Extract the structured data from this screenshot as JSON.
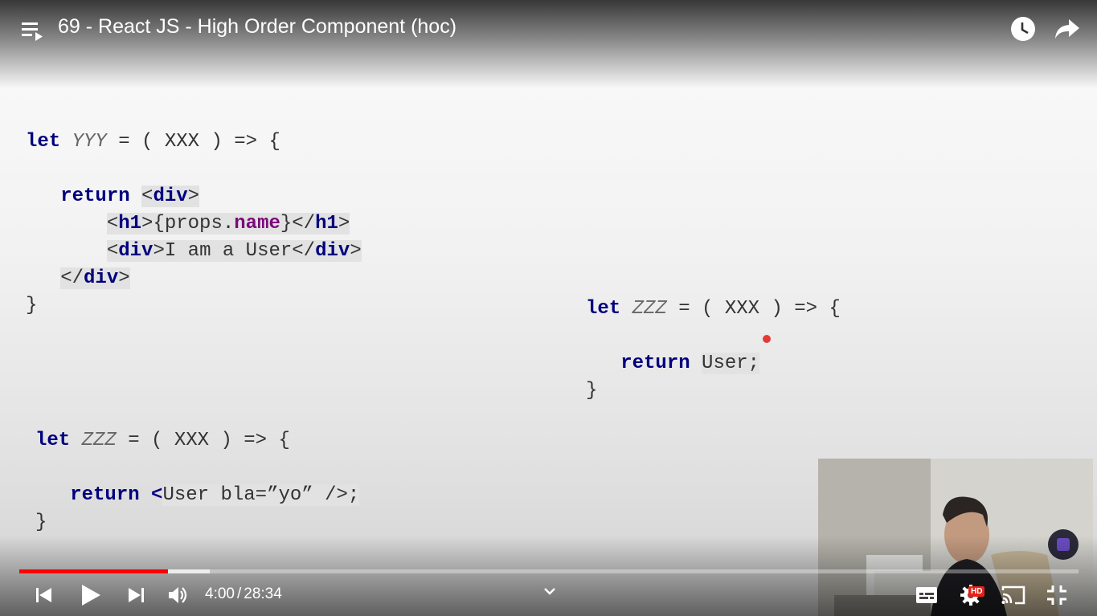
{
  "header": {
    "title": "69 - React JS - High Order Component (hoc)",
    "playlist_icon": "playlist-icon",
    "watch_later_icon": "clock-icon",
    "share_icon": "share-icon"
  },
  "slide": {
    "block1": {
      "l1_kw": "let",
      "l1_name": "YYY",
      "l1_rest": " = ( XXX ) => {",
      "l2_kw": "return",
      "l2_open": "<",
      "l2_tag": "div",
      "l2_close": ">",
      "l3_open": "<",
      "l3_tag": "h1",
      "l3_mid": ">{props.",
      "l3_prop": "name",
      "l3_mid2": "}</",
      "l3_tag2": "h1",
      "l3_close": ">",
      "l4_open": "<",
      "l4_tag": "div",
      "l4_mid": ">I am a User</",
      "l4_tag2": "div",
      "l4_close": ">",
      "l5_open": "</",
      "l5_tag": "div",
      "l5_close": ">",
      "l6": "}"
    },
    "block2": {
      "l1_kw": "let",
      "l1_name": "ZZZ",
      "l1_rest": " = ( XXX ) => {",
      "l2_kw": "return",
      "l2_value": "User;",
      "l3": "}"
    },
    "block3": {
      "l1_kw": "let",
      "l1_name": "ZZZ",
      "l1_rest": " = ( XXX ) => {",
      "l2_kw": "return",
      "l2_open": "<",
      "l2_value": "User bla=”yo” />",
      "l2_end": ";",
      "l3": "}"
    }
  },
  "player": {
    "current_time": "4:00",
    "separator": "/",
    "duration": "28:34",
    "played_fraction": 0.14,
    "buffered_fraction": 0.18,
    "hd_badge": "HD",
    "progress_color": "#ff0000",
    "controls": [
      "previous-icon",
      "play-icon",
      "next-icon",
      "volume-icon",
      "chevron-down-icon",
      "subtitles-icon",
      "settings-icon",
      "cast-icon",
      "exit-fullscreen-icon"
    ]
  }
}
